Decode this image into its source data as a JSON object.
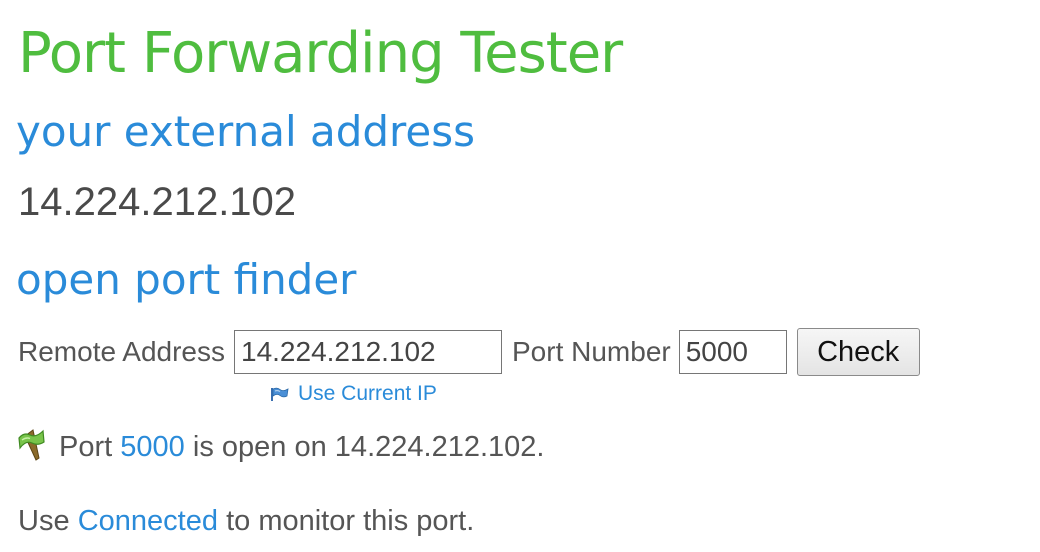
{
  "title": "Port Forwarding Tester",
  "external": {
    "heading": "your external address",
    "ip": "14.224.212.102"
  },
  "finder": {
    "heading": "open port finder",
    "remote_label": "Remote Address",
    "remote_value": "14.224.212.102",
    "port_label": "Port Number",
    "port_value": "5000",
    "check_label": "Check",
    "use_current_ip": "Use Current IP",
    "use_current_ip_icon": "flag-icon"
  },
  "result": {
    "icon": "green-flag-icon",
    "prefix": "Port",
    "port": "5000",
    "suffix": "is open on 14.224.212.102."
  },
  "monitor": {
    "prefix": "Use",
    "link": "Connected",
    "suffix": "to monitor this port."
  },
  "colors": {
    "title": "#4fbd3f",
    "heading": "#2a8bd9",
    "link": "#2a8bd9",
    "text": "#555555"
  }
}
